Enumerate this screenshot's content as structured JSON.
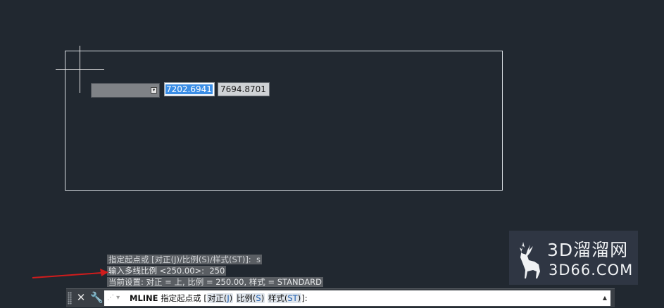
{
  "dynamic_input": {
    "x_value": "7202.6941",
    "y_value": "7694.8701",
    "dropdown_value": ""
  },
  "history": [
    "指定起点或 [对正(J)/比例(S)/样式(ST)]:  s",
    "输入多线比例 <250.00>:  250",
    "当前设置: 对正 = 上, 比例 = 250.00, 样式 = STANDARD"
  ],
  "command_line": {
    "command": "MLINE",
    "prompt": "指定起点或 [",
    "options": [
      {
        "label": "对正(",
        "key": "J",
        "close": ")"
      },
      {
        "label": "比例(",
        "key": "S",
        "close": ")"
      },
      {
        "label": "样式(",
        "key": "ST",
        "close": ")"
      }
    ],
    "suffix": "]:"
  },
  "watermark": {
    "top": "3D溜溜网",
    "bottom": "3D66.COM"
  },
  "colors": {
    "background": "#212830",
    "selection": "#3b8ee6",
    "arrow": "#d01c1c"
  },
  "icons": {
    "close": "close-icon",
    "customize": "wrench-icon",
    "recent": "recent-commands-icon",
    "scroll": "scroll-up-icon"
  }
}
